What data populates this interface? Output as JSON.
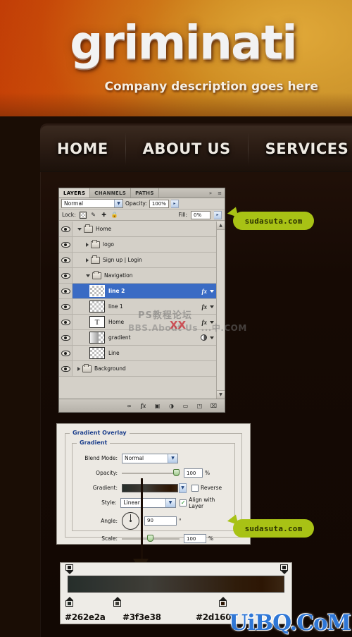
{
  "banner": {
    "logo": "griminati",
    "tagline": "Company description goes here"
  },
  "nav": {
    "items": [
      {
        "label": "HOME"
      },
      {
        "label": "ABOUT US"
      },
      {
        "label": "SERVICES"
      }
    ]
  },
  "layers_panel": {
    "tabs": [
      {
        "label": "LAYERS",
        "active": true
      },
      {
        "label": "CHANNELS",
        "active": false
      },
      {
        "label": "PATHS",
        "active": false
      }
    ],
    "collapse_icon": "»",
    "menu_icon": "≡",
    "blend_mode": "Normal",
    "opacity_label": "Opacity:",
    "opacity_value": "100%",
    "lock_label": "Lock:",
    "fill_label": "Fill:",
    "fill_value": "0%",
    "dropdown_arrow": "▼",
    "spinner_arrow": "▸",
    "lock_icons": [
      "transparency-lock-icon",
      "brush-lock-icon",
      "move-lock-icon",
      "all-lock-icon"
    ],
    "lock_glyphs": [
      "",
      "✐",
      "✛",
      "ὑ2"
    ],
    "rows": [
      {
        "name": "Home",
        "type": "folder",
        "indent": 0,
        "open": true,
        "selected": false,
        "fx": false
      },
      {
        "name": "logo",
        "type": "folder",
        "indent": 1,
        "open": false,
        "selected": false,
        "fx": false
      },
      {
        "name": "Sign up  |  Login",
        "type": "folder",
        "indent": 1,
        "open": false,
        "selected": false,
        "fx": false
      },
      {
        "name": "Navigation",
        "type": "folder",
        "indent": 1,
        "open": true,
        "selected": false,
        "fx": false
      },
      {
        "name": "line 2",
        "type": "layer",
        "indent": 2,
        "open": false,
        "selected": true,
        "fx": true
      },
      {
        "name": "line 1",
        "type": "layer",
        "indent": 2,
        "open": false,
        "selected": false,
        "fx": true
      },
      {
        "name": "Home",
        "type": "text",
        "indent": 2,
        "open": false,
        "selected": false,
        "fx": true,
        "thumb_glyph": "T"
      },
      {
        "name": "gradient",
        "type": "gradient",
        "indent": 2,
        "open": false,
        "selected": false,
        "fx": false,
        "mask": true
      },
      {
        "name": "Line",
        "type": "layer",
        "indent": 2,
        "open": false,
        "selected": false,
        "fx": false
      },
      {
        "name": "Background",
        "type": "folder",
        "indent": 0,
        "open": false,
        "selected": false,
        "fx": false
      }
    ],
    "toolbar_icons": [
      {
        "name": "link-layers-icon",
        "glyph": "∞"
      },
      {
        "name": "layer-style-fx-icon",
        "glyph": "fx"
      },
      {
        "name": "add-mask-icon",
        "glyph": "▣"
      },
      {
        "name": "adjustment-layer-icon",
        "glyph": "◑"
      },
      {
        "name": "new-group-icon",
        "glyph": "▭"
      },
      {
        "name": "new-layer-icon",
        "glyph": "◳"
      },
      {
        "name": "delete-layer-icon",
        "glyph": "⌧"
      }
    ],
    "scroll_up_glyph": "▲",
    "scroll_down_glyph": "▼"
  },
  "gradient_overlay": {
    "title": "Gradient Overlay",
    "section": "Gradient",
    "blend_mode_label": "Blend Mode:",
    "blend_mode_value": "Normal",
    "opacity_label": "Opacity:",
    "opacity_value": "100",
    "opacity_unit": "%",
    "gradient_label": "Gradient:",
    "reverse_label": "Reverse",
    "reverse_checked": false,
    "style_label": "Style:",
    "style_value": "Linear",
    "align_label": "Align with Layer",
    "align_checked": true,
    "angle_label": "Angle:",
    "angle_value": "90",
    "angle_unit": "°",
    "scale_label": "Scale:",
    "scale_value": "100",
    "scale_unit": "%",
    "check_glyph": "✓",
    "dropdown_arrow": "▼"
  },
  "gradient_editor": {
    "stops": [
      {
        "hex": "#262e2a",
        "position": 0
      },
      {
        "hex": "#3f3e38",
        "position": 21
      },
      {
        "hex": "#2d1604",
        "position": 67
      }
    ],
    "hex_labels": [
      "#262e2a",
      "#3f3e38",
      "#2d1604"
    ]
  },
  "watermarks": {
    "bubble_text": "sudasuta.com",
    "uibq": "UiBQ.CoM",
    "cn_forum": "PS教程论坛",
    "cn_bbs": "BBS.About Us ...中.COM",
    "xx": "XX"
  }
}
